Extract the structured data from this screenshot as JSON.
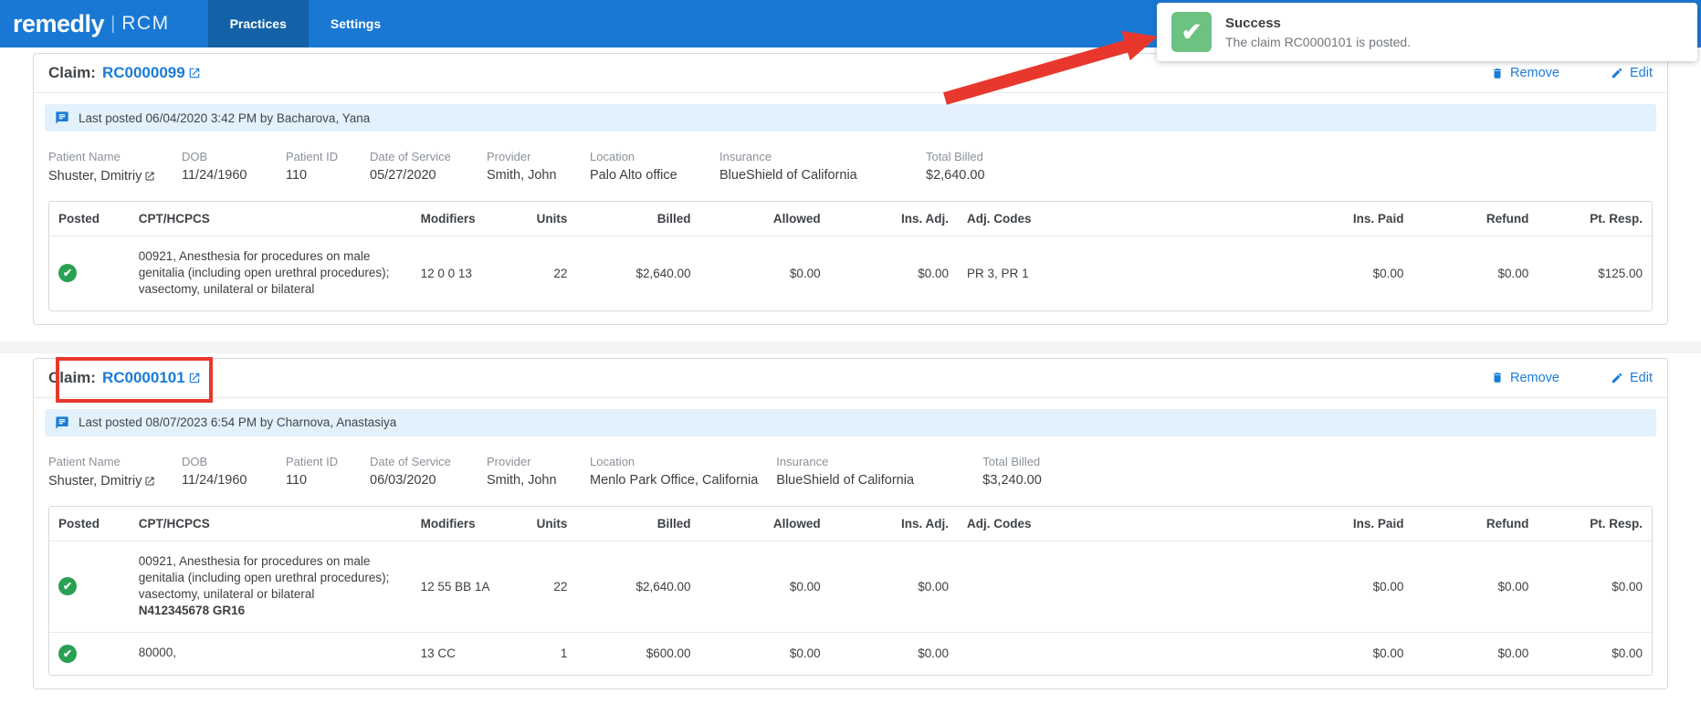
{
  "nav": {
    "brand": "remedly",
    "brand_suffix": "RCM",
    "tabs": [
      {
        "label": "Practices",
        "active": true
      },
      {
        "label": "Settings",
        "active": false
      }
    ]
  },
  "toast": {
    "title": "Success",
    "message": "The claim RC0000101 is posted."
  },
  "labels": {
    "claim": "Claim:",
    "remove": "Remove",
    "edit": "Edit"
  },
  "table_headers": [
    "Posted",
    "CPT/HCPCS",
    "Modifiers",
    "Units",
    "Billed",
    "Allowed",
    "Ins. Adj.",
    "Adj. Codes",
    "Ins. Paid",
    "Refund",
    "Pt. Resp."
  ],
  "claims": [
    {
      "number": "RC0000099",
      "last_posted": "Last posted 06/04/2020 3:42 PM by Bacharova, Yana",
      "fields": [
        {
          "label": "Patient Name",
          "value": "Shuster, Dmitriy"
        },
        {
          "label": "DOB",
          "value": "11/24/1960"
        },
        {
          "label": "Patient ID",
          "value": "110"
        },
        {
          "label": "Date of Service",
          "value": "05/27/2020"
        },
        {
          "label": "Provider",
          "value": "Smith, John"
        },
        {
          "label": "Location",
          "value": "Palo Alto office"
        },
        {
          "label": "Insurance",
          "value": "BlueShield of California"
        },
        {
          "label": "Total Billed",
          "value": "$2,640.00"
        }
      ],
      "rows": [
        {
          "cpt": "00921, Anesthesia for procedures on male genitalia (including open urethral procedures); vasectomy, unilateral or bilateral",
          "cpt_extra": "",
          "modifiers": "12 0 0 13",
          "units": "22",
          "billed": "$2,640.00",
          "allowed": "$0.00",
          "ins_adj": "$0.00",
          "adj_codes": "PR 3, PR 1",
          "ins_paid": "$0.00",
          "refund": "$0.00",
          "pt_resp": "$125.00"
        }
      ]
    },
    {
      "number": "RC0000101",
      "last_posted": "Last posted 08/07/2023 6:54 PM by Charnova, Anastasiya",
      "fields": [
        {
          "label": "Patient Name",
          "value": "Shuster, Dmitriy"
        },
        {
          "label": "DOB",
          "value": "11/24/1960"
        },
        {
          "label": "Patient ID",
          "value": "110"
        },
        {
          "label": "Date of Service",
          "value": "06/03/2020"
        },
        {
          "label": "Provider",
          "value": "Smith, John"
        },
        {
          "label": "Location",
          "value": "Menlo Park Office, California"
        },
        {
          "label": "Insurance",
          "value": "BlueShield of California"
        },
        {
          "label": "Total Billed",
          "value": "$3,240.00"
        }
      ],
      "rows": [
        {
          "cpt": "00921, Anesthesia for procedures on male genitalia (including open urethral procedures); vasectomy, unilateral or bilateral",
          "cpt_extra": "N412345678 GR16",
          "modifiers": "12 55 BB 1A",
          "units": "22",
          "billed": "$2,640.00",
          "allowed": "$0.00",
          "ins_adj": "$0.00",
          "adj_codes": "",
          "ins_paid": "$0.00",
          "refund": "$0.00",
          "pt_resp": "$0.00"
        },
        {
          "cpt": "80000,",
          "cpt_extra": "",
          "modifiers": "13 CC",
          "units": "1",
          "billed": "$600.00",
          "allowed": "$0.00",
          "ins_adj": "$0.00",
          "adj_codes": "",
          "ins_paid": "$0.00",
          "refund": "$0.00",
          "pt_resp": "$0.00"
        }
      ]
    }
  ],
  "icons": {
    "check": "✔"
  },
  "colors": {
    "nav_bg": "#1878d4",
    "nav_active_tab": "#1362a8",
    "link_blue": "#1a7cd8",
    "banner_bg": "#e2f1fb",
    "posted_check_green": "#2aa052",
    "toast_icon_green": "#6cc281",
    "annotation_red": "#e8382e"
  }
}
